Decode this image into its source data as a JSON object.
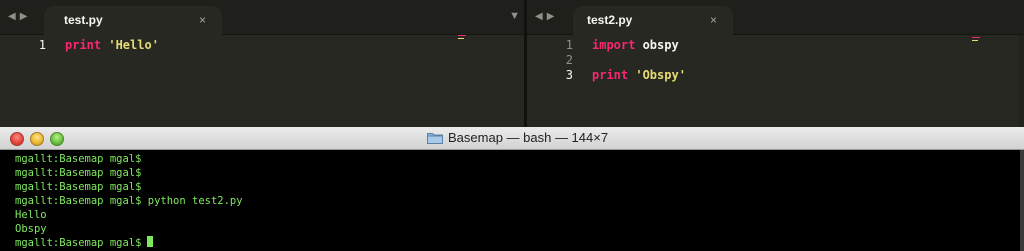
{
  "editor": {
    "left_pane": {
      "tab_label": "test.py",
      "close_glyph": "×",
      "nav_back": "◀",
      "nav_forward": "▶",
      "dropdown_glyph": "▼",
      "lines": [
        {
          "number": "1",
          "tokens": [
            {
              "text": "print",
              "kind": "keyword"
            },
            {
              "text": " ",
              "kind": "space"
            },
            {
              "text": "'Hello'",
              "kind": "string"
            }
          ]
        }
      ]
    },
    "right_pane": {
      "tab_label": "test2.py",
      "close_glyph": "×",
      "nav_back": "◀",
      "nav_forward": "▶",
      "lines": [
        {
          "number": "1",
          "tokens": [
            {
              "text": "import",
              "kind": "keyword"
            },
            {
              "text": " obspy",
              "kind": "identifier"
            }
          ]
        },
        {
          "number": "2",
          "tokens": []
        },
        {
          "number": "3",
          "tokens": [
            {
              "text": "print",
              "kind": "keyword"
            },
            {
              "text": " ",
              "kind": "space"
            },
            {
              "text": "'Obspy'",
              "kind": "string"
            }
          ]
        }
      ]
    }
  },
  "terminal": {
    "title": "Basemap — bash — 144×7",
    "lines": [
      "mgallt:Basemap mgal$",
      "mgallt:Basemap mgal$",
      "mgallt:Basemap mgal$",
      "mgallt:Basemap mgal$ python test2.py",
      "Hello",
      "Obspy",
      "mgallt:Basemap mgal$"
    ]
  },
  "colors": {
    "keyword": "#f92672",
    "string": "#e6db74",
    "identifier": "#f8f8f2",
    "terminal_text": "#7fe860",
    "editor_bg": "#272822"
  },
  "icons": [
    "folder-icon",
    "close-icon",
    "dropdown-arrow-icon",
    "back-arrow-icon",
    "forward-arrow-icon"
  ]
}
